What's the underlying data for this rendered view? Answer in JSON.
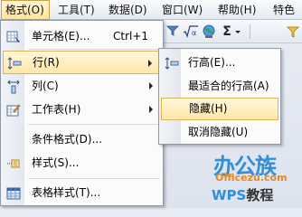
{
  "menubar": {
    "items": [
      {
        "label": "格式(O)"
      },
      {
        "label": "工具(T)"
      },
      {
        "label": "数据(D)"
      },
      {
        "label": "窗口(W)"
      },
      {
        "label": "帮助(H)"
      },
      {
        "label": "特色"
      }
    ]
  },
  "toolbar": {
    "icons": [
      "filter-icon",
      "sqrt-function-icon",
      "globe-icon",
      "sum-icon",
      "dropdown-arrow-icon",
      "sort-icon"
    ]
  },
  "menu": {
    "items": [
      {
        "label": "单元格(E)...",
        "shortcut": "Ctrl+1",
        "icon": "cell-format-icon"
      },
      {
        "label": "行(R)",
        "icon": "row-icon",
        "submenu": true
      },
      {
        "label": "列(C)",
        "icon": "column-icon",
        "submenu": true
      },
      {
        "label": "工作表(H)",
        "icon": "worksheet-icon",
        "submenu": true
      },
      {
        "label": "条件格式(D)...",
        "icon": ""
      },
      {
        "label": "样式(S)...",
        "icon": "style-icon"
      },
      {
        "label": "表格样式(T)...",
        "icon": "table-style-icon"
      }
    ]
  },
  "submenu": {
    "items": [
      {
        "label": "行高(E)...",
        "icon": "row-height-icon"
      },
      {
        "label": "最适合的行高(A)",
        "icon": ""
      },
      {
        "label": "隐藏(H)",
        "icon": ""
      },
      {
        "label": "取消隐藏(U)",
        "icon": ""
      }
    ]
  },
  "watermark": {
    "title": "办公族",
    "url": "Officezu.com",
    "brand": "WPS",
    "suffix": "教程"
  },
  "colors": {
    "highlight": "#ffe7a6",
    "highlight_border": "#d9b45a",
    "watermark_blue": "#2f8fd8",
    "watermark_orange": "#e6891e"
  }
}
